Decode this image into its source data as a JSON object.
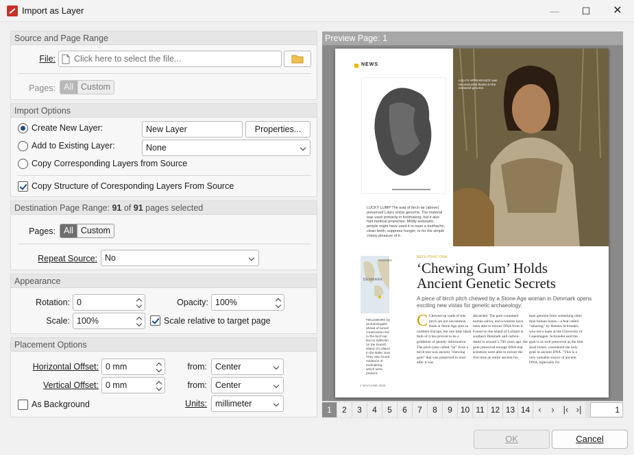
{
  "window": {
    "title": "Import as Layer"
  },
  "source": {
    "header": "Source and Page Range",
    "file_label": "File:",
    "file_placeholder": "Click here to select the file...",
    "pages_label": "Pages:",
    "pages_all": "All",
    "pages_custom": "Custom"
  },
  "import_options": {
    "header": "Import Options",
    "create_new": "Create New Layer:",
    "new_layer_value": "New Layer",
    "properties_btn": "Properties...",
    "add_existing": "Add to Existing Layer:",
    "existing_value": "None",
    "copy_corresponding": "Copy Corresponding Layers from Source",
    "copy_structure": "Copy Structure of Coresponding Layers From Source"
  },
  "destination": {
    "header_prefix": "Destination Page Range: ",
    "selected": "91",
    "of_word": " of ",
    "total": "91",
    "suffix": " pages selected",
    "pages_label": "Pages:",
    "pages_all": "All",
    "pages_custom": "Custom",
    "repeat_label": "Repeat Source:",
    "repeat_value": "No"
  },
  "appearance": {
    "header": "Appearance",
    "rotation_label": "Rotation:",
    "rotation_value": "0",
    "opacity_label": "Opacity:",
    "opacity_value": "100%",
    "scale_label": "Scale:",
    "scale_value": "100%",
    "scale_relative": "Scale relative to target page"
  },
  "placement": {
    "header": "Placement Options",
    "h_offset_label": "Horizontal Offset:",
    "h_offset_value": "0 mm",
    "v_offset_label": "Vertical Offset:",
    "v_offset_value": "0 mm",
    "from_label": "from:",
    "h_from_value": "Center",
    "v_from_value": "Center",
    "units_label": "Units:",
    "units_value": "millimeter",
    "as_background": "As Background"
  },
  "preview": {
    "header": "Preview Page: 1",
    "page_numbers": [
      "1",
      "2",
      "3",
      "4",
      "5",
      "6",
      "7",
      "8",
      "9",
      "10",
      "11",
      "12",
      "13",
      "14"
    ],
    "current_page": "1",
    "article": {
      "section": "NEWS",
      "kicker": "NEOLITHIC DNA",
      "headline_1": "‘Chewing Gum’ Holds",
      "headline_2": "Ancient Genetic Secrets",
      "dek": "A piece of birch pitch chewed by a Stone Age woman in Denmark opens exciting new vistas for genetic archaeology.",
      "map_label_1": "SWEDEN",
      "map_label_2": "DENMARK",
      "map_caption": "FIELDWORK by archaeologists ahead of tunnel construction led to the birch-tar find at Syltholm on the Danish island of Lolland in the Baltic Sea. They also found evidence of toolmaking, which were present.",
      "gum_caption": "LUCKY LUMP The wad of birch tar (above) preserved Lola's entire genome. The material was used primarily in toolmaking, but it also had medical properties. Mildly antiseptic, people might have used it to ease a toothache, clean teeth, suppress hunger, or for the simple chewy pleasure of it.",
      "photo_caption": "LOLA'S APPEARANCE was reconstructed thanks to the extracted genome.",
      "body_col1": "Chewed-up wads of tree pitch are not uncommon finds at Stone Age sites in northern Europe, but one little black blob of it has proved to be a goldmine of genetic information. The pitch (also called \"tar\" from a birch tree was ancient \"chewing gum\" that was preserved in mud after it was",
      "body_col2": "discarded. The gum contained human saliva, and scientists have been able to extract DNA from it. Found on the island of Lolland in southern Denmark and carbon-dated to around 5,700 years ago, the gum preserved enough DNA that scientists were able to extract the first time an entire ancient hu-",
      "body_col3": "man genome from something other than human bones—a feat called \"amazing\" by Hannes Schroeder, who led a team at the University of Copenhagen. Schroeder said the gum is as well preserved as the best skull bones, considered the holy grail in ancient DNA. \"This is a very valuable source of ancient DNA, especially for",
      "folio": "2  MAY/JUNE 2020"
    }
  },
  "footer": {
    "ok": "OK",
    "cancel": "Cancel"
  }
}
